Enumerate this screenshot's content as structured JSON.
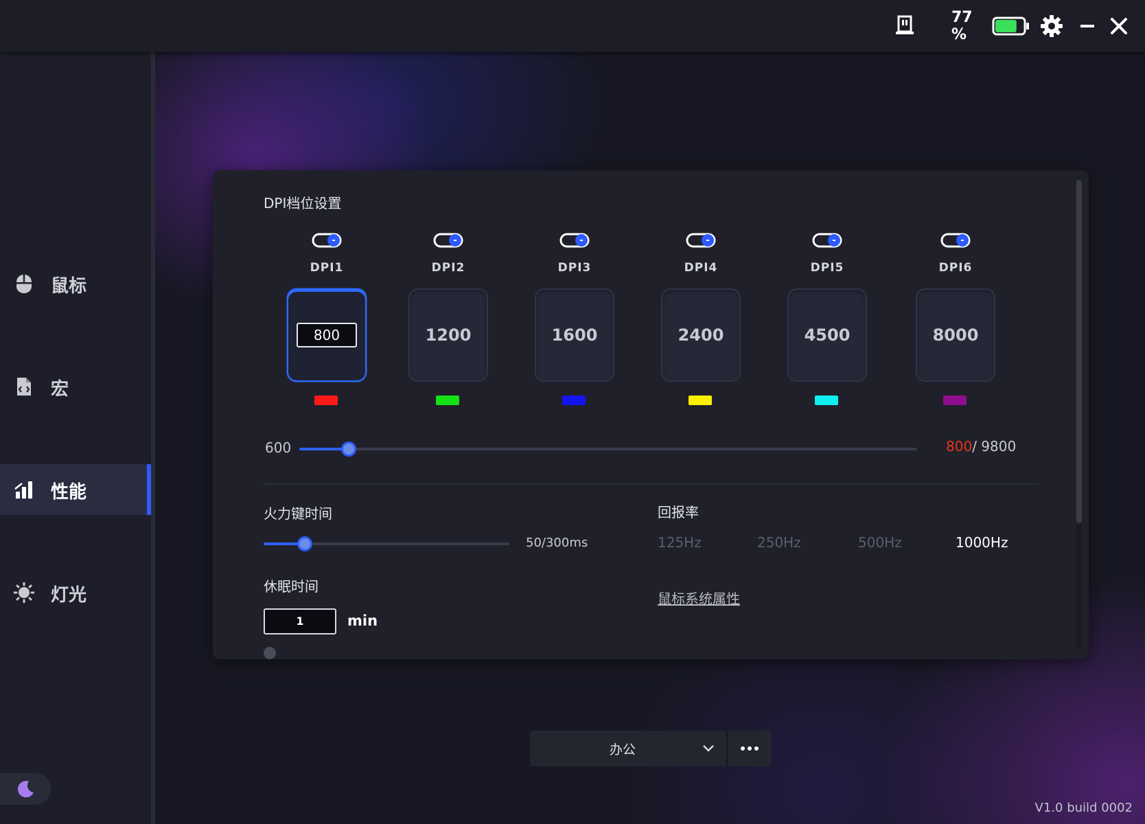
{
  "titlebar": {
    "battery_text": "77 %",
    "battery_level": 0.77,
    "battery_color": "#3be05a",
    "icons": [
      "dongle-icon",
      "battery-icon",
      "gear-icon",
      "minimize-icon",
      "close-icon"
    ]
  },
  "sidebar": {
    "items": [
      {
        "label": "鼠标",
        "icon": "mouse-icon",
        "active": false
      },
      {
        "label": "宏",
        "icon": "macro-file-icon",
        "active": false
      },
      {
        "label": "性能",
        "icon": "bar-chart-icon",
        "active": true
      },
      {
        "label": "灯光",
        "icon": "light-sun-icon",
        "active": false
      }
    ],
    "theme_icon": "moon-icon"
  },
  "dpi": {
    "title": "DPI档位设置",
    "levels": [
      {
        "label": "DPI1",
        "value": "800",
        "color": "#ff1a1a",
        "enabled": true,
        "selected": true
      },
      {
        "label": "DPI2",
        "value": "1200",
        "color": "#16e016",
        "enabled": true,
        "selected": false
      },
      {
        "label": "DPI3",
        "value": "1600",
        "color": "#1414f0",
        "enabled": true,
        "selected": false
      },
      {
        "label": "DPI4",
        "value": "2400",
        "color": "#fbf000",
        "enabled": true,
        "selected": false
      },
      {
        "label": "DPI5",
        "value": "4500",
        "color": "#10f0f0",
        "enabled": true,
        "selected": false
      },
      {
        "label": "DPI6",
        "value": "8000",
        "color": "#8e0e8e",
        "enabled": true,
        "selected": false
      }
    ],
    "slider_min_label": "600",
    "current": "800",
    "max_suffix": "/ 9800",
    "current_color": "#e8341c",
    "slider_fraction": 0.08
  },
  "fire_key": {
    "title": "火力键时间",
    "value_text": "50/300ms",
    "slider_fraction": 0.167
  },
  "report_rate": {
    "title": "回报率",
    "options": [
      "125Hz",
      "250Hz",
      "500Hz",
      "1000Hz"
    ],
    "selected_index": 3
  },
  "sleep": {
    "title": "休眠时间",
    "value": "1",
    "unit": "min"
  },
  "mouse_props_link": "鼠标系统属性",
  "profile": {
    "name": "办公",
    "more_icon": "more-dots-icon"
  },
  "version": "V1.0 build 0002"
}
